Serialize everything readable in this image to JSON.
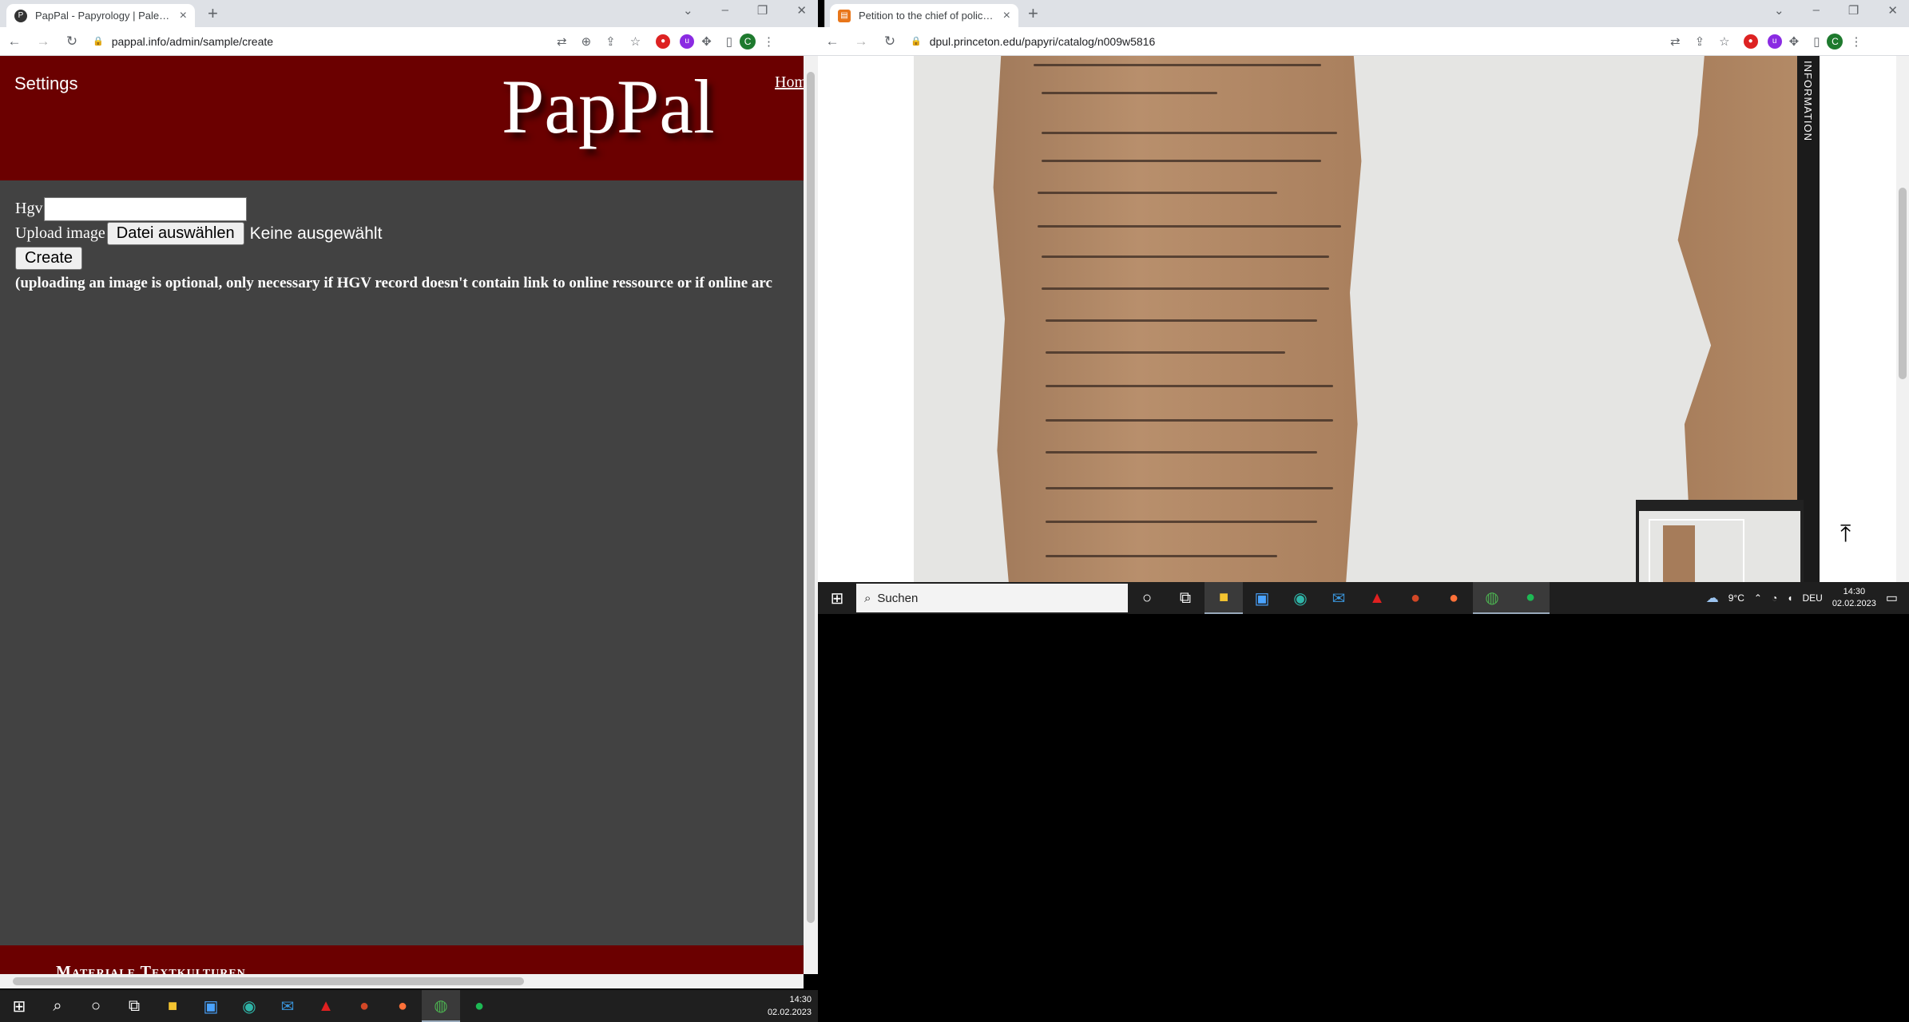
{
  "left_window": {
    "tab": {
      "title": "PapPal - Papyrology | Paleography",
      "favicon_icon": "pappal-icon"
    },
    "url": "pappal.info/admin/sample/create",
    "page": {
      "settings_label": "Settings",
      "logo_text": "PapPal",
      "home_link": "Home",
      "hgv_label": "Hgv",
      "upload_label": "Upload image",
      "choose_file_button": "Datei auswählen",
      "no_file_text": "Keine ausgewählt",
      "create_button": "Create",
      "note": "(uploading an image is optional, only necessary if HGV record doesn't contain link to online ressource or if online arc",
      "footer_title": "Materiale Textkulturen"
    },
    "header_color": "#6b0000",
    "background_color": "#424242"
  },
  "right_window": {
    "tab": {
      "title": "Petition to the chief of police - D",
      "favicon_icon": "dpul-icon"
    },
    "url": "dpul.princeton.edu/papyri/catalog/n009w5816",
    "sidebar_label": "INFORMATION"
  },
  "taskbar": {
    "search_placeholder": "Suchen",
    "weather": "9°C",
    "language": "DEU",
    "time": "14:30",
    "date": "02.02.2023",
    "icons": [
      "windows-start-icon",
      "search-icon",
      "cortana-icon",
      "task-view-icon",
      "file-explorer-icon",
      "store-icon",
      "edge-icon",
      "mail-icon",
      "acrobat-icon",
      "powerpoint-icon",
      "firefox-icon",
      "chrome-icon",
      "spotify-icon"
    ]
  }
}
